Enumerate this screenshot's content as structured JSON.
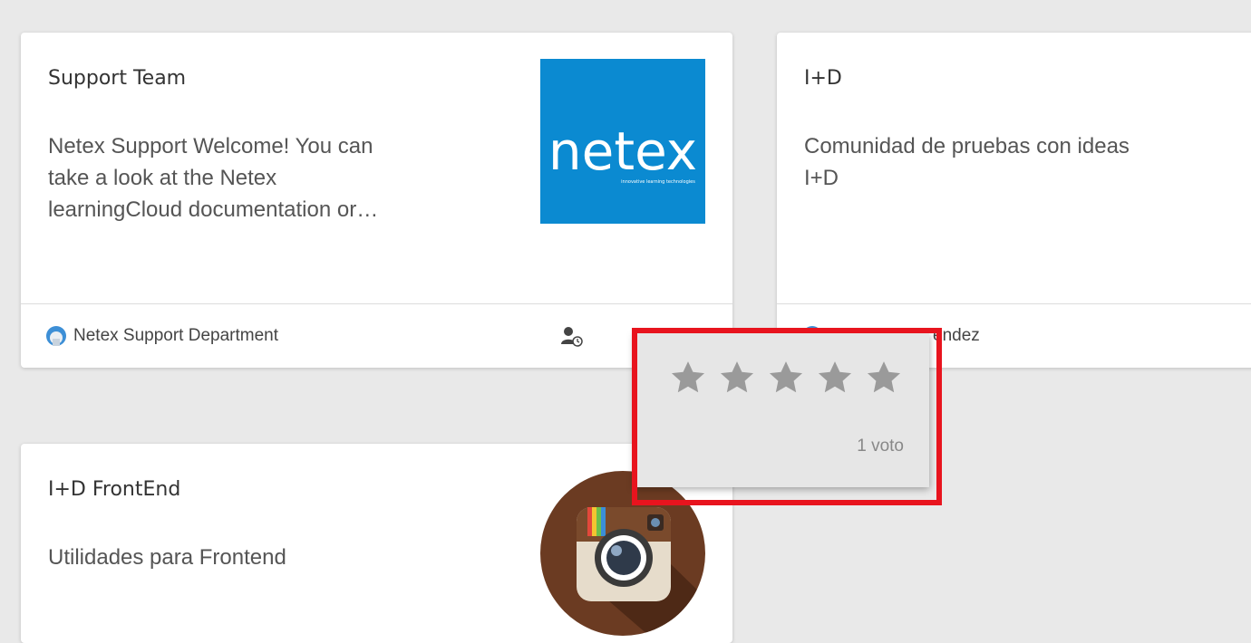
{
  "cards": [
    {
      "title": "Support Team",
      "description_lines": [
        "Netex Support Welcome! You can",
        "take a look at the Netex",
        "learningCloud documentation or…"
      ],
      "owner": "Netex Support Department",
      "logo": {
        "word": "netex",
        "tagline": "innovative learning technologies",
        "color": "#0b8ad1"
      }
    },
    {
      "title": "I+D",
      "description_lines": [
        "Comunidad de pruebas con ideas",
        "I+D"
      ],
      "owner": "éndez"
    },
    {
      "title": "I+D FrontEnd",
      "description_lines": [
        "Utilidades para Frontend"
      ],
      "logo": {
        "icon": "instagram-camera-icon",
        "color": "#6b3b22"
      }
    }
  ],
  "rating_popup": {
    "stars_total": 5,
    "stars_filled": 0,
    "votes_label": "1 voto",
    "star_color": "#9a9a9a"
  },
  "highlight_color": "#e8141e"
}
